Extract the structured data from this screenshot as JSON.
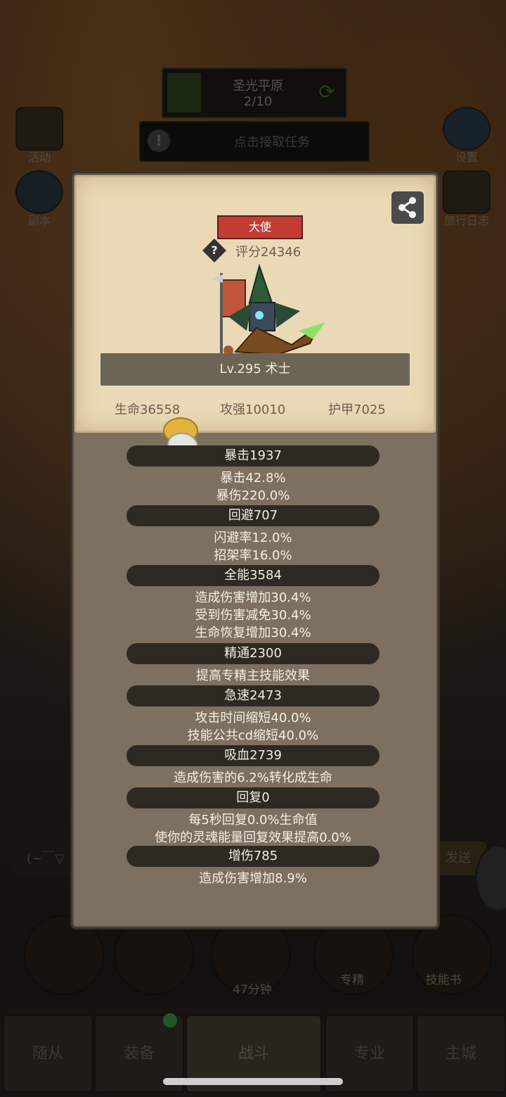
{
  "background": {
    "zone_title": "圣光平原",
    "zone_progress": "2/10",
    "task_prompt": "点击接取任务",
    "left_buttons": [
      "活动",
      "副本"
    ],
    "right_buttons": [
      "设置",
      "旅行日志"
    ],
    "timer": "47分钟",
    "action_labels": [
      "专精",
      "技能书"
    ],
    "nav_tabs": [
      "随从",
      "装备",
      "战斗",
      "专业",
      "主城"
    ],
    "input_hint": "(~￣▽",
    "send_label": "发送"
  },
  "card": {
    "title_badge": "大使",
    "score": "评分24346",
    "level_class": "Lv.295 术士",
    "hp": "生命36558",
    "attack": "攻强10010",
    "armor": "护甲7025"
  },
  "sections": [
    {
      "header": "暴击1937",
      "lines": [
        "暴击42.8%",
        "暴伤220.0%"
      ]
    },
    {
      "header": "回避707",
      "lines": [
        "闪避率12.0%",
        "招架率16.0%"
      ]
    },
    {
      "header": "全能3584",
      "lines": [
        "造成伤害增加30.4%",
        "受到伤害减免30.4%",
        "生命恢复增加30.4%"
      ]
    },
    {
      "header": "精通2300",
      "lines": [
        "提高专精主技能效果"
      ]
    },
    {
      "header": "急速2473",
      "lines": [
        "攻击时间缩短40.0%",
        "技能公共cd缩短40.0%"
      ]
    },
    {
      "header": "吸血2739",
      "lines": [
        "造成伤害的6.2%转化成生命"
      ]
    },
    {
      "header": "回复0",
      "lines": [
        "每5秒回复0.0%生命值",
        "使你的灵魂能量回复效果提高0.0%"
      ]
    },
    {
      "header": "增伤785",
      "lines": [
        "造成伤害增加8.9%"
      ]
    }
  ]
}
